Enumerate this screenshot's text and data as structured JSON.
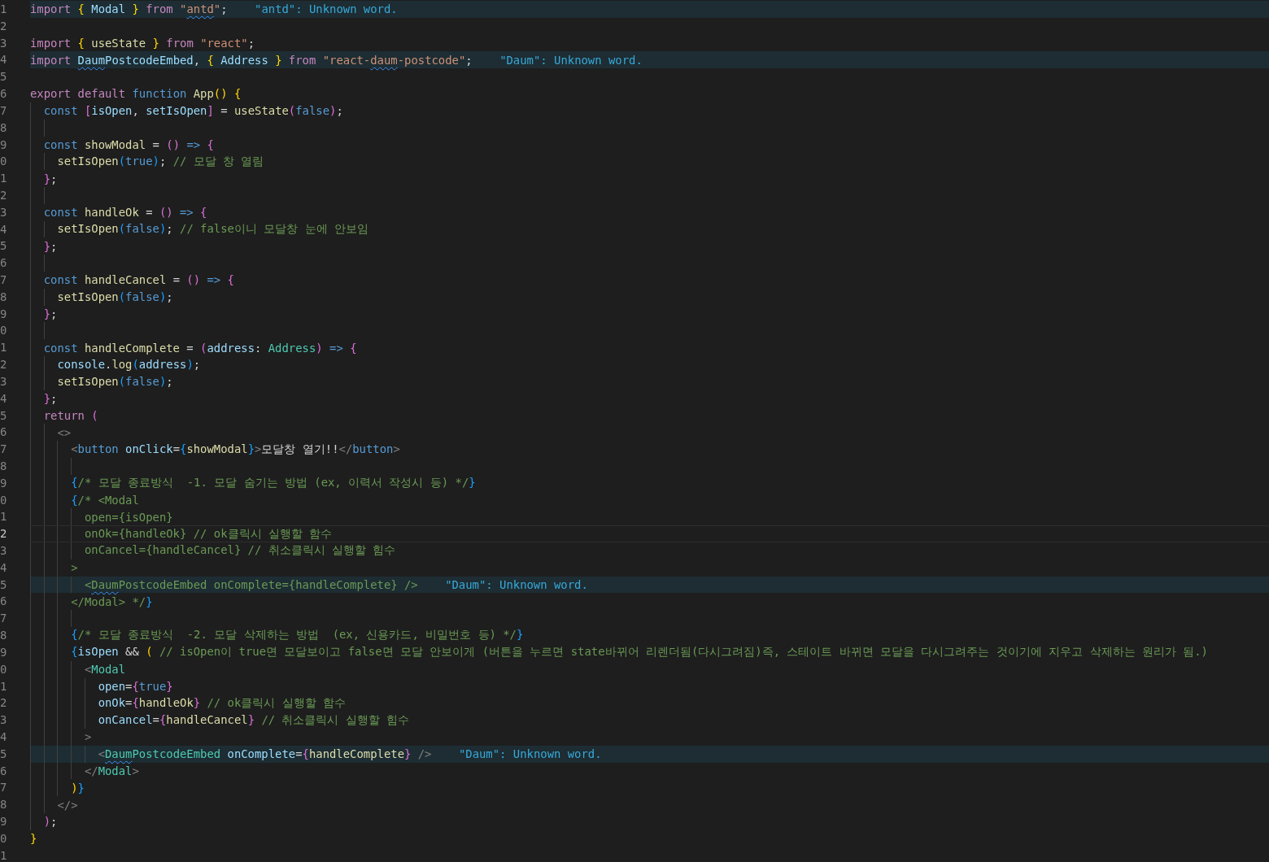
{
  "editor": {
    "lines": [
      {
        "number": "1",
        "current": false,
        "diagnostic": "\"antd\": Unknown word.",
        "tokens": [
          {
            "text": "import",
            "kind": "k"
          },
          {
            "text": " {",
            "kind": "b1"
          },
          {
            "text": " Modal ",
            "kind": "v"
          },
          {
            "text": "}",
            "kind": "b1"
          },
          {
            "text": " from ",
            "kind": "k"
          },
          {
            "text": "\"",
            "kind": "str"
          },
          {
            "text": "antd",
            "kind": "str",
            "misspelled": true
          },
          {
            "text": "\"",
            "kind": "str"
          },
          {
            "text": ";",
            "kind": "p"
          }
        ]
      },
      {
        "number": "2",
        "current": false
      },
      {
        "number": "3",
        "current": false,
        "tokens": [
          {
            "text": "import",
            "kind": "k"
          },
          {
            "text": " {",
            "kind": "b1"
          },
          {
            "text": " useState ",
            "kind": "f"
          },
          {
            "text": "}",
            "kind": "b1"
          },
          {
            "text": " from ",
            "kind": "k"
          },
          {
            "text": "\"react\"",
            "kind": "str"
          },
          {
            "text": ";",
            "kind": "p"
          }
        ]
      },
      {
        "number": "4",
        "current": false,
        "diagnostic": "\"Daum\": Unknown word.",
        "tokens": [
          {
            "text": "import",
            "kind": "k"
          },
          {
            "text": " Daum",
            "kind": "v",
            "misspelled": true
          },
          {
            "text": "PostcodeEmbed",
            "kind": "v"
          },
          {
            "text": ", ",
            "kind": "p"
          },
          {
            "text": "{",
            "kind": "b1"
          },
          {
            "text": " Address ",
            "kind": "v"
          },
          {
            "text": "}",
            "kind": "b1"
          },
          {
            "text": " from ",
            "kind": "k"
          },
          {
            "text": "\"react-",
            "kind": "str"
          },
          {
            "text": "daum",
            "kind": "str",
            "misspelled": true
          },
          {
            "text": "-postcode\"",
            "kind": "str"
          },
          {
            "text": ";",
            "kind": "p"
          }
        ]
      },
      {
        "number": "5",
        "current": false
      },
      {
        "number": "6",
        "current": false,
        "tokens": [
          {
            "text": "export default ",
            "kind": "k"
          },
          {
            "text": "function ",
            "kind": "s"
          },
          {
            "text": "App",
            "kind": "f"
          },
          {
            "text": "()",
            "kind": "b1"
          },
          {
            "text": " {",
            "kind": "b1"
          }
        ]
      },
      {
        "number": "7",
        "current": false,
        "tokens": [
          {
            "text": "  const ",
            "kind": "s"
          },
          {
            "text": "[",
            "kind": "b2"
          },
          {
            "text": "isOpen",
            "kind": "v"
          },
          {
            "text": ", ",
            "kind": "p"
          },
          {
            "text": "setIsOpen",
            "kind": "v"
          },
          {
            "text": "]",
            "kind": "b2"
          },
          {
            "text": " = ",
            "kind": "p"
          },
          {
            "text": "useState",
            "kind": "f"
          },
          {
            "text": "(",
            "kind": "b2"
          },
          {
            "text": "false",
            "kind": "lit"
          },
          {
            "text": ")",
            "kind": "b2"
          },
          {
            "text": ";",
            "kind": "p"
          }
        ]
      },
      {
        "number": "8",
        "current": false
      },
      {
        "number": "9",
        "current": false,
        "tokens": [
          {
            "text": "  const ",
            "kind": "s"
          },
          {
            "text": "showModal",
            "kind": "f"
          },
          {
            "text": " = ",
            "kind": "p"
          },
          {
            "text": "()",
            "kind": "b2"
          },
          {
            "text": " =>",
            "kind": "s"
          },
          {
            "text": " {",
            "kind": "b2"
          }
        ]
      },
      {
        "number": "0",
        "current": false,
        "tokens": [
          {
            "text": "    setIsOpen",
            "kind": "f"
          },
          {
            "text": "(",
            "kind": "b3"
          },
          {
            "text": "true",
            "kind": "lit"
          },
          {
            "text": ")",
            "kind": "b3"
          },
          {
            "text": "; ",
            "kind": "p"
          },
          {
            "text": "// 모달 창 열림",
            "kind": "c"
          }
        ]
      },
      {
        "number": "1",
        "current": false,
        "tokens": [
          {
            "text": "  }",
            "kind": "b2"
          },
          {
            "text": ";",
            "kind": "p"
          }
        ]
      },
      {
        "number": "2",
        "current": false
      },
      {
        "number": "3",
        "current": false,
        "tokens": [
          {
            "text": "  const ",
            "kind": "s"
          },
          {
            "text": "handleOk",
            "kind": "f"
          },
          {
            "text": " = ",
            "kind": "p"
          },
          {
            "text": "()",
            "kind": "b2"
          },
          {
            "text": " =>",
            "kind": "s"
          },
          {
            "text": " {",
            "kind": "b2"
          }
        ]
      },
      {
        "number": "4",
        "current": false,
        "tokens": [
          {
            "text": "    setIsOpen",
            "kind": "f"
          },
          {
            "text": "(",
            "kind": "b3"
          },
          {
            "text": "false",
            "kind": "lit"
          },
          {
            "text": ")",
            "kind": "b3"
          },
          {
            "text": "; ",
            "kind": "p"
          },
          {
            "text": "// false이니 모달창 눈에 안보임",
            "kind": "c"
          }
        ]
      },
      {
        "number": "5",
        "current": false,
        "tokens": [
          {
            "text": "  }",
            "kind": "b2"
          },
          {
            "text": ";",
            "kind": "p"
          }
        ]
      },
      {
        "number": "6",
        "current": false
      },
      {
        "number": "7",
        "current": false,
        "tokens": [
          {
            "text": "  const ",
            "kind": "s"
          },
          {
            "text": "handleCancel",
            "kind": "f"
          },
          {
            "text": " = ",
            "kind": "p"
          },
          {
            "text": "()",
            "kind": "b2"
          },
          {
            "text": " =>",
            "kind": "s"
          },
          {
            "text": " {",
            "kind": "b2"
          }
        ]
      },
      {
        "number": "8",
        "current": false,
        "tokens": [
          {
            "text": "    setIsOpen",
            "kind": "f"
          },
          {
            "text": "(",
            "kind": "b3"
          },
          {
            "text": "false",
            "kind": "lit"
          },
          {
            "text": ")",
            "kind": "b3"
          },
          {
            "text": ";",
            "kind": "p"
          }
        ]
      },
      {
        "number": "9",
        "current": false,
        "tokens": [
          {
            "text": "  }",
            "kind": "b2"
          },
          {
            "text": ";",
            "kind": "p"
          }
        ]
      },
      {
        "number": "0",
        "current": false
      },
      {
        "number": "1",
        "current": false,
        "tokens": [
          {
            "text": "  const ",
            "kind": "s"
          },
          {
            "text": "handleComplete",
            "kind": "f"
          },
          {
            "text": " = ",
            "kind": "p"
          },
          {
            "text": "(",
            "kind": "b2"
          },
          {
            "text": "address",
            "kind": "v"
          },
          {
            "text": ": ",
            "kind": "p"
          },
          {
            "text": "Address",
            "kind": "ty"
          },
          {
            "text": ")",
            "kind": "b2"
          },
          {
            "text": " =>",
            "kind": "s"
          },
          {
            "text": " {",
            "kind": "b2"
          }
        ]
      },
      {
        "number": "2",
        "current": false,
        "tokens": [
          {
            "text": "    console",
            "kind": "v"
          },
          {
            "text": ".",
            "kind": "p"
          },
          {
            "text": "log",
            "kind": "f"
          },
          {
            "text": "(",
            "kind": "b3"
          },
          {
            "text": "address",
            "kind": "v"
          },
          {
            "text": ")",
            "kind": "b3"
          },
          {
            "text": ";",
            "kind": "p"
          }
        ]
      },
      {
        "number": "3",
        "current": false,
        "tokens": [
          {
            "text": "    setIsOpen",
            "kind": "f"
          },
          {
            "text": "(",
            "kind": "b3"
          },
          {
            "text": "false",
            "kind": "lit"
          },
          {
            "text": ")",
            "kind": "b3"
          },
          {
            "text": ";",
            "kind": "p"
          }
        ]
      },
      {
        "number": "4",
        "current": false,
        "tokens": [
          {
            "text": "  }",
            "kind": "b2"
          },
          {
            "text": ";",
            "kind": "p"
          }
        ]
      },
      {
        "number": "5",
        "current": false,
        "tokens": [
          {
            "text": "  return ",
            "kind": "k"
          },
          {
            "text": "(",
            "kind": "b2"
          }
        ]
      },
      {
        "number": "6",
        "current": false,
        "tokens": [
          {
            "text": "    <>",
            "kind": "tg"
          }
        ]
      },
      {
        "number": "7",
        "current": false,
        "tokens": [
          {
            "text": "      <",
            "kind": "tg"
          },
          {
            "text": "button",
            "kind": "tn"
          },
          {
            "text": " onClick",
            "kind": "a"
          },
          {
            "text": "=",
            "kind": "p"
          },
          {
            "text": "{",
            "kind": "b3"
          },
          {
            "text": "showModal",
            "kind": "f"
          },
          {
            "text": "}",
            "kind": "b3"
          },
          {
            "text": ">",
            "kind": "tg"
          },
          {
            "text": "모달창 열기!!",
            "kind": "p"
          },
          {
            "text": "</",
            "kind": "tg"
          },
          {
            "text": "button",
            "kind": "tn"
          },
          {
            "text": ">",
            "kind": "tg"
          }
        ]
      },
      {
        "number": "8",
        "current": false
      },
      {
        "number": "9",
        "current": false,
        "tokens": [
          {
            "text": "      {",
            "kind": "b3"
          },
          {
            "text": "/* 모달 종료방식  -1. 모달 숨기는 방법 (ex, 이력서 작성시 등) */",
            "kind": "c"
          },
          {
            "text": "}",
            "kind": "b3"
          }
        ]
      },
      {
        "number": "0",
        "current": false,
        "tokens": [
          {
            "text": "      {",
            "kind": "b3"
          },
          {
            "text": "/* <Modal",
            "kind": "c"
          }
        ]
      },
      {
        "number": "1",
        "current": false,
        "tokens": [
          {
            "text": "        open={isOpen}",
            "kind": "c"
          }
        ]
      },
      {
        "number": "2",
        "current": true,
        "tokens": [
          {
            "text": "        onOk={handleOk} // ok클릭시 실행할 함수",
            "kind": "c"
          }
        ]
      },
      {
        "number": "3",
        "current": false,
        "tokens": [
          {
            "text": "        onCancel={handleCancel} // 취소클릭시 실행할 힘수",
            "kind": "c"
          }
        ]
      },
      {
        "number": "4",
        "current": false,
        "tokens": [
          {
            "text": "      >",
            "kind": "c"
          }
        ]
      },
      {
        "number": "5",
        "current": false,
        "diagnostic": "\"Daum\": Unknown word.",
        "tokens": [
          {
            "text": "        <",
            "kind": "c"
          },
          {
            "text": "Daum",
            "kind": "c",
            "misspelled": true
          },
          {
            "text": "PostcodeEmbed onComplete={handleComplete} />",
            "kind": "c"
          }
        ]
      },
      {
        "number": "6",
        "current": false,
        "tokens": [
          {
            "text": "      </Modal> */",
            "kind": "c"
          },
          {
            "text": "}",
            "kind": "b3"
          }
        ]
      },
      {
        "number": "7",
        "current": false
      },
      {
        "number": "8",
        "current": false,
        "tokens": [
          {
            "text": "      {",
            "kind": "b3"
          },
          {
            "text": "/* 모달 종료방식  -2. 모달 삭제하는 방법  (ex, 신용카드, 비밀번호 등) */",
            "kind": "c"
          },
          {
            "text": "}",
            "kind": "b3"
          }
        ]
      },
      {
        "number": "9",
        "current": false,
        "tokens": [
          {
            "text": "      {",
            "kind": "b3"
          },
          {
            "text": "isOpen",
            "kind": "v"
          },
          {
            "text": " && ",
            "kind": "p"
          },
          {
            "text": "(",
            "kind": "b1"
          },
          {
            "text": " // isOpen이 true면 모달보이고 false면 모달 안보이게 (버튼을 누르면 state바뀌어 리렌더됨(다시그려짐)즉, 스테이트 바뀌면 모달을 다시그려주는 것이기에 지우고 삭제하는 원리가 됨.)",
            "kind": "c"
          }
        ]
      },
      {
        "number": "0",
        "current": false,
        "tokens": [
          {
            "text": "        <",
            "kind": "tg"
          },
          {
            "text": "Modal",
            "kind": "cp"
          }
        ]
      },
      {
        "number": "1",
        "current": false,
        "tokens": [
          {
            "text": "          open",
            "kind": "a"
          },
          {
            "text": "=",
            "kind": "p"
          },
          {
            "text": "{",
            "kind": "b2"
          },
          {
            "text": "true",
            "kind": "lit"
          },
          {
            "text": "}",
            "kind": "b2"
          }
        ]
      },
      {
        "number": "2",
        "current": false,
        "tokens": [
          {
            "text": "          onOk",
            "kind": "a"
          },
          {
            "text": "=",
            "kind": "p"
          },
          {
            "text": "{",
            "kind": "b2"
          },
          {
            "text": "handleOk",
            "kind": "f"
          },
          {
            "text": "}",
            "kind": "b2"
          },
          {
            "text": " // ok클릭시 실행할 함수",
            "kind": "c"
          }
        ]
      },
      {
        "number": "3",
        "current": false,
        "tokens": [
          {
            "text": "          onCancel",
            "kind": "a"
          },
          {
            "text": "=",
            "kind": "p"
          },
          {
            "text": "{",
            "kind": "b2"
          },
          {
            "text": "handleCancel",
            "kind": "f"
          },
          {
            "text": "}",
            "kind": "b2"
          },
          {
            "text": " // 취소클릭시 실행할 힘수",
            "kind": "c"
          }
        ]
      },
      {
        "number": "4",
        "current": false,
        "tokens": [
          {
            "text": "        >",
            "kind": "tg"
          }
        ]
      },
      {
        "number": "5",
        "current": false,
        "diagnostic": "\"Daum\": Unknown word.",
        "tokens": [
          {
            "text": "          <",
            "kind": "tg"
          },
          {
            "text": "Daum",
            "kind": "cp",
            "misspelled": true
          },
          {
            "text": "PostcodeEmbed",
            "kind": "cp"
          },
          {
            "text": " onComplete",
            "kind": "a"
          },
          {
            "text": "=",
            "kind": "p"
          },
          {
            "text": "{",
            "kind": "b2"
          },
          {
            "text": "handleComplete",
            "kind": "f"
          },
          {
            "text": "}",
            "kind": "b2"
          },
          {
            "text": " />",
            "kind": "tg"
          }
        ]
      },
      {
        "number": "6",
        "current": false,
        "tokens": [
          {
            "text": "        </",
            "kind": "tg"
          },
          {
            "text": "Modal",
            "kind": "cp"
          },
          {
            "text": ">",
            "kind": "tg"
          }
        ]
      },
      {
        "number": "7",
        "current": false,
        "tokens": [
          {
            "text": "      )",
            "kind": "b1"
          },
          {
            "text": "}",
            "kind": "b3"
          }
        ]
      },
      {
        "number": "8",
        "current": false,
        "tokens": [
          {
            "text": "    </>",
            "kind": "tg"
          }
        ]
      },
      {
        "number": "9",
        "current": false,
        "tokens": [
          {
            "text": "  )",
            "kind": "b2"
          },
          {
            "text": ";",
            "kind": "p"
          }
        ]
      },
      {
        "number": "0",
        "current": false,
        "tokens": [
          {
            "text": "}",
            "kind": "b1"
          }
        ]
      },
      {
        "number": "1",
        "current": false
      }
    ]
  }
}
